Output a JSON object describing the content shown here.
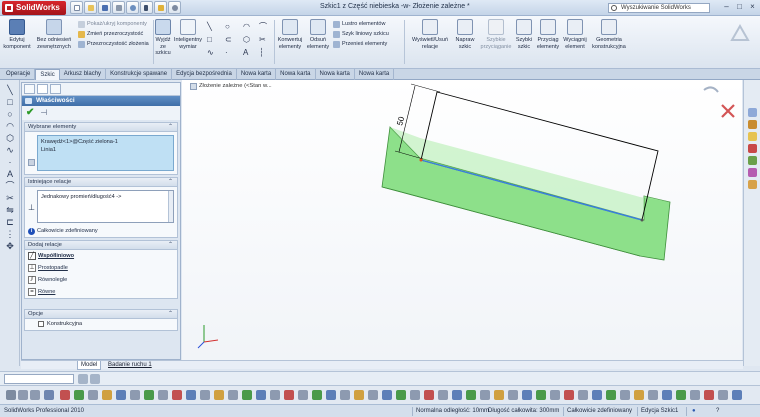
{
  "app": {
    "logo": "SolidWorks",
    "window_title": "Szkic1 z Część niebieska -w- Złożenie zależne *",
    "search_placeholder": "Wyszukiwanie SolidWorks",
    "window_buttons": [
      "–",
      "□",
      "×"
    ]
  },
  "ribbon": {
    "edit_component": "Edytuj komponent",
    "no_external": "Bez odniesień zewnętrznych",
    "show_hide": "Pokaż/ukryj komponenty",
    "change_transparency": "Zmień przezroczystość",
    "assembly_transparency": "Przezroczystość złożenia",
    "exit_sketch": "Wyjdź ze szkicu",
    "smart_dimension": "Inteligentny wymiar",
    "convert_entities": "Konwertuj elementy",
    "offset_entities": "Odsuń elementy",
    "mirror_entities": "Lustro elementów",
    "linear_pattern": "Szyk liniowy szkicu",
    "move_entities": "Przenieś elementy",
    "display_relations": "Wyświetl/Usuń relacje",
    "repair_sketch": "Napraw szkic",
    "rapid_sketch": "Szybkie przyciąganie",
    "quick_sketch": "Szybki szkic",
    "snaps": "Przyciąg elementy",
    "extrude": "Wyciągnij element",
    "construction_geometry": "Geometria konstrukcyjna"
  },
  "tabs": [
    "Operacje",
    "Szkic",
    "Arkusz blachy",
    "Konstrukcje spawane",
    "Edycja bezpośrednia",
    "Nowa karta",
    "Nowa karta",
    "Nowa karta",
    "Nowa karta"
  ],
  "property_manager": {
    "title": "Właściwości",
    "selected_entities_header": "Wybrane elementy",
    "selected_entities": [
      "Krawędź<1>@Część zielona-1",
      "Linia1"
    ],
    "existing_relations_header": "Istniejące relacje",
    "existing_relations": [
      "Jednakowy promień/długość4 ->"
    ],
    "fully_defined": "Całkowicie zdefiniowany",
    "add_relations_header": "Dodaj relacje",
    "add_relations": [
      "Współliniowo",
      "Prostopadle",
      "Równolegle",
      "Równe"
    ],
    "options_header": "Opcje",
    "construction": "Konstrukcyjna"
  },
  "graphics": {
    "breadcrumb": "Złożenie zależne  (<Stan w...",
    "dimension_value": "50",
    "part_color": "#8de08a"
  },
  "model_tabs": [
    "Model",
    "Badanie ruchu 1"
  ],
  "status": {
    "product": "SolidWorks Professional 2010",
    "normal_distance": "Normalna odległość: 10mm",
    "total_length": "Długość całkowita: 300mm",
    "fully_defined": "Całkowicie zdefiniowany",
    "editing": "Edycja Szkic1",
    "help": "?"
  }
}
